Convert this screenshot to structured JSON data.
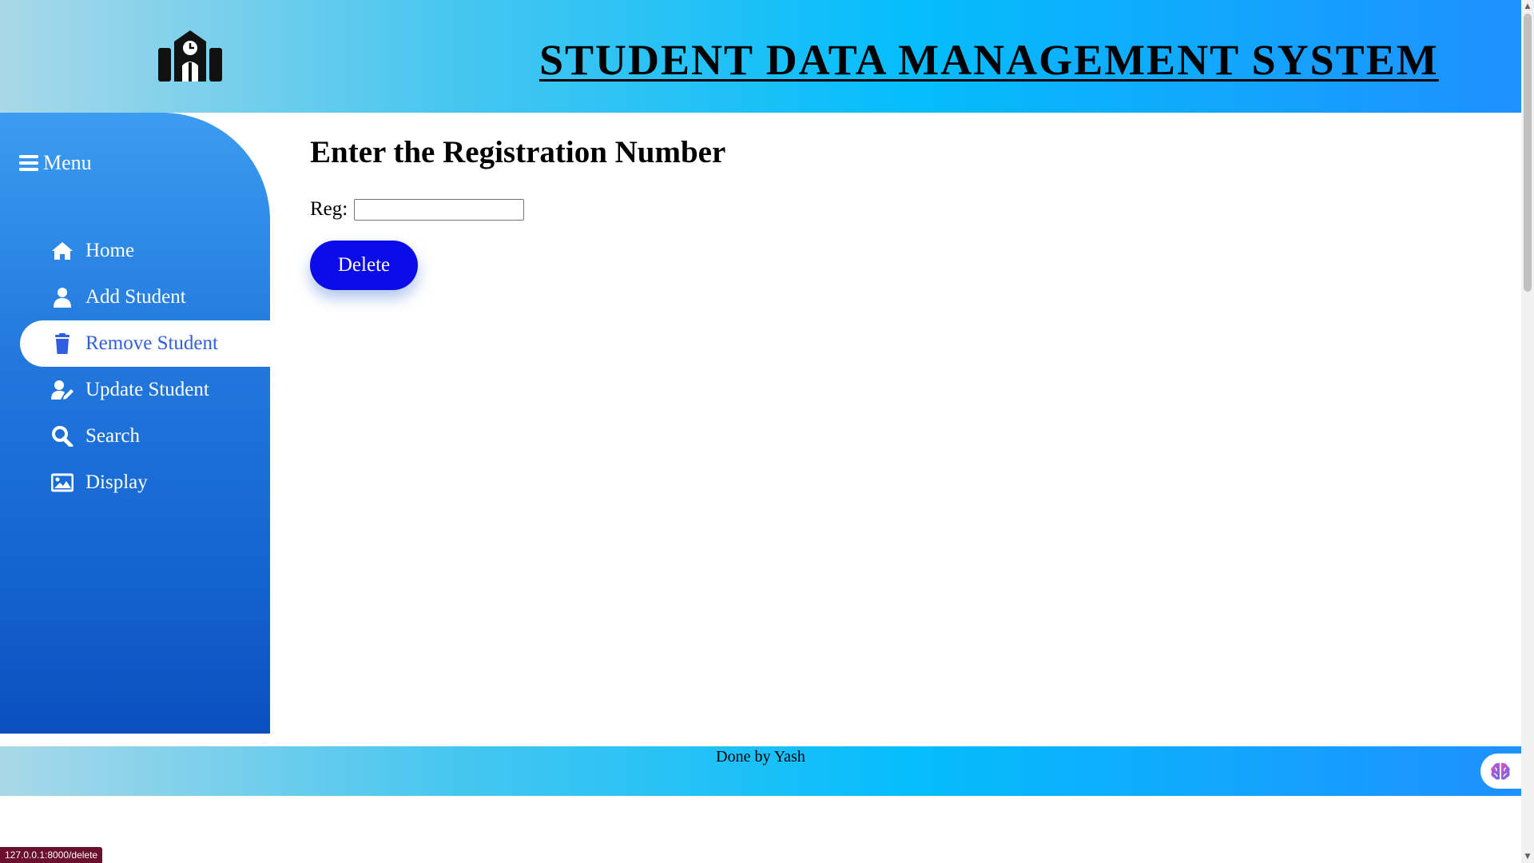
{
  "header": {
    "logo_icon": "school-building-icon",
    "title": "STUDENT DATA MANAGEMENT SYSTEM"
  },
  "sidebar": {
    "menu_label": "Menu",
    "menu_icon": "hamburger-icon",
    "items": [
      {
        "label": "Home",
        "icon": "home-icon",
        "active": false
      },
      {
        "label": "Add Student",
        "icon": "user-icon",
        "active": false
      },
      {
        "label": "Remove Student",
        "icon": "trash-icon",
        "active": true
      },
      {
        "label": "Update Student",
        "icon": "user-edit-icon",
        "active": false
      },
      {
        "label": "Search",
        "icon": "search-icon",
        "active": false
      },
      {
        "label": "Display",
        "icon": "image-icon",
        "active": false
      }
    ]
  },
  "main": {
    "heading": "Enter the Registration Number",
    "reg_label": "Reg:",
    "reg_value": "",
    "delete_label": "Delete"
  },
  "footer": {
    "text": "Done by Yash"
  },
  "browser": {
    "status_url": "127.0.0.1:8000/delete",
    "extension_icon": "brain-icon"
  },
  "colors": {
    "sidebar_top": "#3c9cf0",
    "sidebar_bottom": "#0b4fc0",
    "active_text": "#2f5fe0",
    "delete_button": "#0c0ce8",
    "header_left": "#a9d8e8",
    "header_right": "#1e90ff"
  }
}
